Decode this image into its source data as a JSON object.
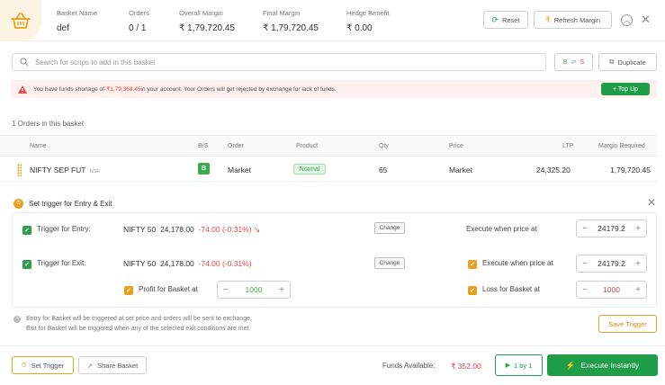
{
  "header": {
    "basket_name_label": "Basket Name",
    "basket_name": "def",
    "orders_label": "Orders",
    "orders_value": "0 / 1",
    "overall_margin_label": "Overall Margin",
    "overall_margin": "₹ 1,79,720.45",
    "final_margin_label": "Final Margin",
    "final_margin": "₹ 1,79,720.45",
    "hedge_benefit_label": "Hedge Benefit",
    "hedge_benefit": "₹ 0.00",
    "reset_label": "Reset",
    "refresh_label": "Refresh Margin"
  },
  "search": {
    "placeholder": "Search for scrips to add in this basket",
    "bs_label_b": "B",
    "bs_label_s": "S",
    "duplicate_label": "Duplicate"
  },
  "warning": {
    "text_before": "You have funds shortage of ",
    "amount": "-₹1,79,368.45",
    "text_after": " in your account. Your Orders will get rejected by exchange for lack of funds.",
    "topup_label": "+ Top Up"
  },
  "orders": {
    "count_text": "1 Orders in this basket",
    "columns": [
      "Name",
      "B/S",
      "Order",
      "Product",
      "Qty",
      "Price",
      "LTP",
      "Margin Required"
    ],
    "rows": [
      {
        "name": "NIFTY SEP FUT",
        "exchange": "NSE",
        "bs": "B",
        "order": "Market",
        "product": "Normal",
        "qty": "65",
        "price": "Market",
        "ltp": "24,325.20",
        "margin": "1,79,720.45"
      }
    ]
  },
  "trigger": {
    "title": "Set trigger for Entry & Exit",
    "entry": {
      "label": "Trigger for Entry:",
      "instrument": "NIFTY 50",
      "price": "24,178.00",
      "change": "-74.00 (-0.31%)",
      "change_label": "Change",
      "execute_label": "Execute when price at",
      "execute_value": "24179.2"
    },
    "exit": {
      "label": "Trigger for Exit:",
      "instrument": "NIFTY 50",
      "price": "24,178.00",
      "change": "-74.00 (-0.31%)",
      "change_label": "Change",
      "execute_label": "Execute when price at",
      "execute_value": "24179.2",
      "profit_label": "Profit for Basket at",
      "profit_value": "1000",
      "loss_label": "Loss for Basket at",
      "loss_value": "1000"
    },
    "note_1": "Entry for Basket will be triggered at set price and orders will be sent to exchange.",
    "note_2": "Exit for Basket will be triggered when any of the selected exit conditions are met.",
    "save_label": "Save Trigger"
  },
  "footer": {
    "set_trigger_label": "Set Trigger",
    "share_label": "Share Basket",
    "funds_label": "Funds Available:",
    "funds_value": "₹ 352.00",
    "one_by_one_label": "1 by 1",
    "execute_label": "Execute Instantly"
  },
  "colors": {
    "green": "#1f9d49",
    "red": "#e04646",
    "orange": "#e8a020",
    "accent_bg": "#fdf3e3"
  }
}
